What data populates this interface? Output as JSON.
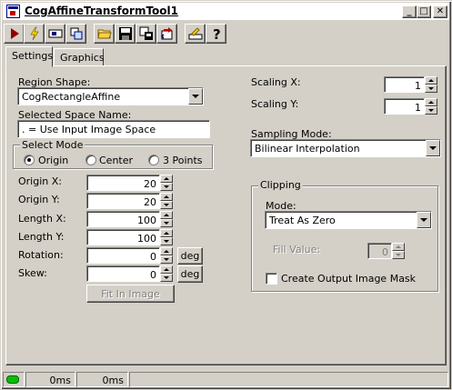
{
  "window": {
    "title": "CogAffineTransformTool1",
    "controls": {
      "minimize": "_",
      "maximize": "□",
      "close": "✕"
    }
  },
  "toolbar": {
    "buttons": [
      {
        "name": "run",
        "icon": "run-icon"
      },
      {
        "name": "electric",
        "icon": "lightning-icon"
      },
      {
        "name": "image-display",
        "icon": "image-display-icon"
      },
      {
        "name": "region",
        "icon": "region-icon"
      },
      {
        "name": "open",
        "icon": "open-folder-icon"
      },
      {
        "name": "save",
        "icon": "save-icon"
      },
      {
        "name": "properties",
        "icon": "properties-icon"
      },
      {
        "name": "reset",
        "icon": "reset-icon"
      },
      {
        "name": "settings",
        "icon": "settings-icon"
      },
      {
        "name": "help",
        "icon": "help-icon"
      }
    ]
  },
  "tabs": [
    {
      "label": "Settings",
      "active": true
    },
    {
      "label": "Graphics",
      "active": false
    }
  ],
  "left": {
    "region_shape_label": "Region Shape:",
    "region_shape_value": "CogRectangleAffine",
    "selected_space_label": "Selected Space Name:",
    "selected_space_value": ". = Use Input Image Space",
    "select_mode": {
      "label": "Select Mode",
      "options": [
        {
          "label": "Origin",
          "checked": true
        },
        {
          "label": "Center",
          "checked": false
        },
        {
          "label": "3 Points",
          "checked": false
        }
      ]
    },
    "params": [
      {
        "label": "Origin X:",
        "value": "20"
      },
      {
        "label": "Origin Y:",
        "value": "20"
      },
      {
        "label": "Length X:",
        "value": "100"
      },
      {
        "label": "Length Y:",
        "value": "100"
      },
      {
        "label": "Rotation:",
        "value": "0",
        "unit": "deg"
      },
      {
        "label": "Skew:",
        "value": "0",
        "unit": "deg"
      }
    ],
    "fit_button": "Fit In Image"
  },
  "right": {
    "scaling_x_label": "Scaling X:",
    "scaling_x_value": "1",
    "scaling_y_label": "Scaling Y:",
    "scaling_y_value": "1",
    "sampling_label": "Sampling Mode:",
    "sampling_value": "Bilinear Interpolation",
    "clipping": {
      "label": "Clipping",
      "mode_label": "Mode:",
      "mode_value": "Treat As Zero",
      "fill_label": "Fill Value:",
      "fill_value": "0",
      "mask_label": "Create Output Image Mask",
      "mask_checked": false
    }
  },
  "status": {
    "indicator_color": "#00c000",
    "time1": "0ms",
    "time2": "0ms"
  }
}
